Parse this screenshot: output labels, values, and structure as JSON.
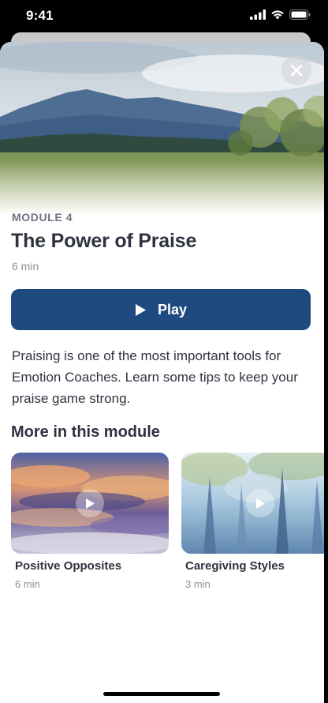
{
  "status_bar": {
    "time": "9:41",
    "icons": [
      "signal-icon",
      "wifi-icon",
      "battery-icon"
    ]
  },
  "header": {
    "close_icon": "close-icon"
  },
  "module": {
    "label": "MODULE 4",
    "title": "The Power of Praise",
    "duration": "6 min"
  },
  "play_button": {
    "label": "Play",
    "icon": "play-icon"
  },
  "description": "Praising is one of the most important tools for Emotion Coaches. Learn some tips to keep your praise game strong.",
  "more_section": {
    "title": "More in this module",
    "items": [
      {
        "title": "Positive Opposites",
        "duration": "6 min"
      },
      {
        "title": "Caregiving Styles",
        "duration": "3 min"
      }
    ]
  },
  "colors": {
    "accent": "#1f4a80",
    "text_primary": "#2f3340",
    "text_secondary": "#8a8f98",
    "label": "#6c7380"
  }
}
